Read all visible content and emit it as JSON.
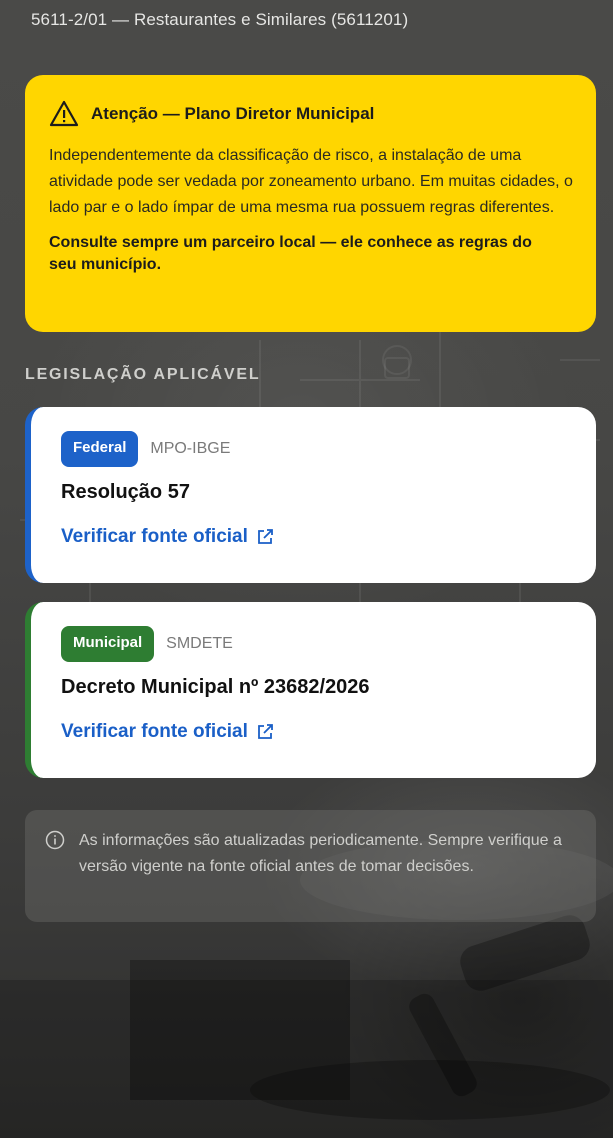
{
  "header": {
    "activity_code_line": "5611-2/01 — Restaurantes e Similares (5611201)"
  },
  "alert": {
    "icon": "warning-triangle-icon",
    "title": "Atenção — Plano Diretor Municipal",
    "body": "Independentemente da classificação de risco, a instalação de uma atividade pode ser vedada por zoneamento urbano. Em muitas cidades, o lado par e o lado ímpar de uma mesma rua possuem regras diferentes.",
    "cta": "Consulte sempre um parceiro local — ele conhece as regras do seu município.",
    "background_color": "#ffd600"
  },
  "legislation": {
    "section_label": "LEGISLAÇÃO APLICÁVEL",
    "items": [
      {
        "level": "Federal",
        "source": "MPO-IBGE",
        "title": "Resolução 57",
        "link_label": "Verificar fonte oficial",
        "accent_color": "#1d62c9"
      },
      {
        "level": "Municipal",
        "source": "SMDETE",
        "title": "Decreto Municipal nº 23682/2026",
        "link_label": "Verificar fonte oficial",
        "accent_color": "#2e7d32"
      }
    ]
  },
  "info": {
    "icon": "info-circle-icon",
    "text": "As informações são atualizadas periodicamente. Sempre verifique a versão vigente na fonte oficial antes de tomar decisões."
  },
  "colors": {
    "link": "#1a5fc7",
    "page_background": "#3f3f3e"
  }
}
